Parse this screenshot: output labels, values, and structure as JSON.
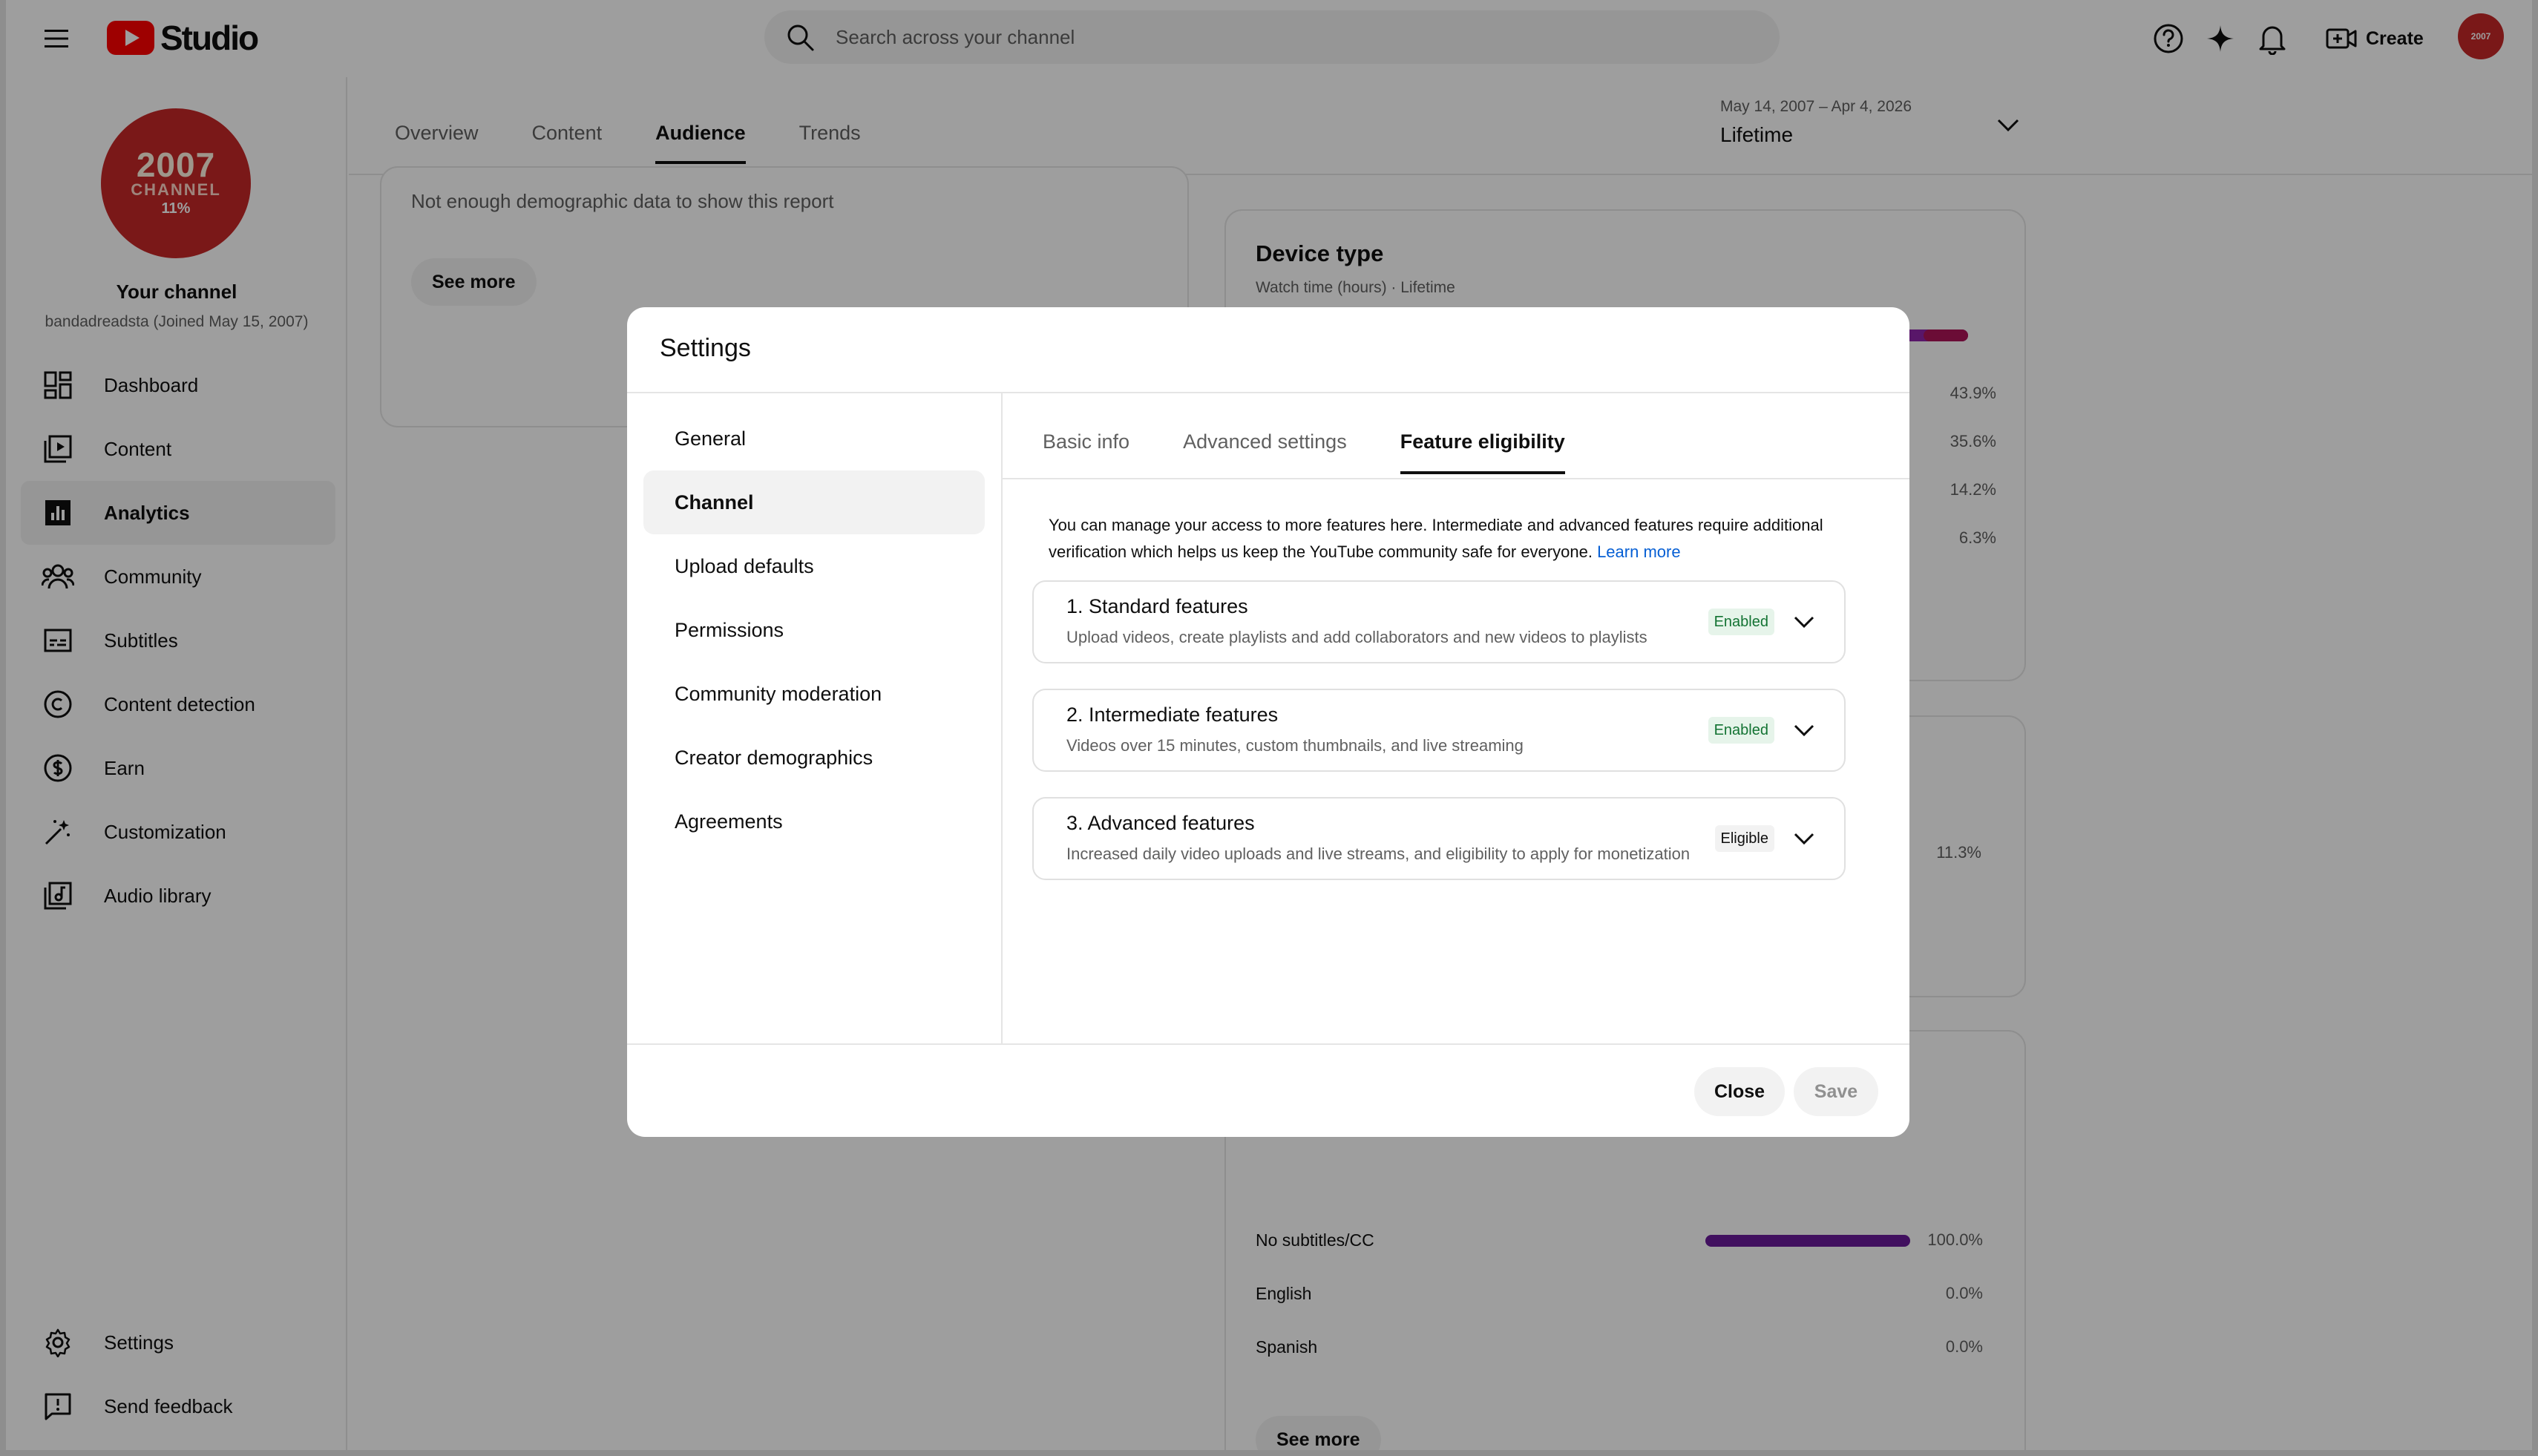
{
  "header": {
    "logo_text": "Studio",
    "search_placeholder": "Search across your channel",
    "create_label": "Create",
    "avatar_text": "2007"
  },
  "sidebar": {
    "avatar": {
      "year": "2007",
      "line": "CHANNEL",
      "pct": "11%"
    },
    "channel_name": "Your channel",
    "channel_sub": "bandadreadsta (Joined May 15, 2007)",
    "items": [
      {
        "label": "Dashboard",
        "icon": "dashboard-icon"
      },
      {
        "label": "Content",
        "icon": "content-icon"
      },
      {
        "label": "Analytics",
        "icon": "analytics-icon",
        "active": true
      },
      {
        "label": "Community",
        "icon": "community-icon"
      },
      {
        "label": "Subtitles",
        "icon": "subtitles-icon"
      },
      {
        "label": "Content detection",
        "icon": "copyright-icon"
      },
      {
        "label": "Earn",
        "icon": "earn-icon"
      },
      {
        "label": "Customization",
        "icon": "magic-wand-icon"
      },
      {
        "label": "Audio library",
        "icon": "audio-library-icon"
      }
    ],
    "bottom_items": [
      {
        "label": "Settings",
        "icon": "gear-icon"
      },
      {
        "label": "Send feedback",
        "icon": "feedback-icon"
      }
    ]
  },
  "main": {
    "tabs": [
      {
        "label": "Overview"
      },
      {
        "label": "Content"
      },
      {
        "label": "Audience",
        "active": true
      },
      {
        "label": "Trends"
      }
    ],
    "date": {
      "range": "May 14, 2007 – Apr 4, 2026",
      "label": "Lifetime"
    },
    "left_card": {
      "message": "Not enough demographic data to show this report",
      "button": "See more"
    },
    "device_card": {
      "title": "Device type",
      "subtitle": "Watch time (hours) · Lifetime",
      "percents": [
        "43.9%",
        "35.6%",
        "14.2%",
        "6.3%"
      ]
    },
    "mid_card": {
      "percent": "11.3%"
    },
    "subtitles_card": {
      "rows": [
        {
          "label": "No subtitles/CC",
          "value": "100.0%",
          "fraction": 1.0
        },
        {
          "label": "English",
          "value": "0.0%",
          "fraction": 0.0
        },
        {
          "label": "Spanish",
          "value": "0.0%",
          "fraction": 0.0
        }
      ],
      "button": "See more"
    }
  },
  "modal": {
    "title": "Settings",
    "nav": [
      {
        "label": "General"
      },
      {
        "label": "Channel",
        "active": true
      },
      {
        "label": "Upload defaults"
      },
      {
        "label": "Permissions"
      },
      {
        "label": "Community moderation"
      },
      {
        "label": "Creator demographics"
      },
      {
        "label": "Agreements"
      }
    ],
    "tabs": [
      {
        "label": "Basic info"
      },
      {
        "label": "Advanced settings"
      },
      {
        "label": "Feature eligibility",
        "active": true
      }
    ],
    "intro": "You can manage your access to more features here. Intermediate and advanced features require additional verification which helps us keep the YouTube community safe for everyone.",
    "learn_more": "Learn more",
    "features": [
      {
        "title": "1. Standard features",
        "desc": "Upload videos, create playlists and add collaborators and new videos to playlists",
        "status": "Enabled"
      },
      {
        "title": "2. Intermediate features",
        "desc": "Videos over 15 minutes, custom thumbnails, and live streaming",
        "status": "Enabled"
      },
      {
        "title": "3. Advanced features",
        "desc": "Increased daily video uploads and live streams, and eligibility to apply for monetization",
        "status": "Eligible"
      }
    ],
    "close_label": "Close",
    "save_label": "Save"
  },
  "colors": {
    "accent_purple": "#6a1b9a",
    "device_bar_1": "#8e24aa",
    "device_bar_2": "#ad1457",
    "enabled_bg": "#e6f4ea",
    "enabled_text": "#137333",
    "link": "#065fd4",
    "brand_red": "#ff0000"
  }
}
